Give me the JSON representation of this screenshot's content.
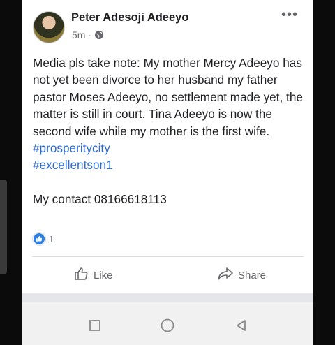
{
  "post": {
    "author": "Peter Adesoji Adeeyo",
    "time": "5m",
    "separator": "·",
    "privacy_icon": "globe-icon",
    "more_icon": "more-options-icon",
    "more_label": "•••",
    "body": [
      "Media pls take note: My mother Mercy Adeeyo has not yet been divorce to her husband my father pastor Moses Adeeyo, no settlement made yet, the matter is still in court. Tina Adeeyo is  now the second wife while my mother is the first wife."
    ],
    "hashtags": [
      "#prosperitycity",
      "#excellentson1"
    ],
    "contact": "My contact 08166618113"
  },
  "reactions": {
    "icon": "like-reaction-icon",
    "count": "1"
  },
  "actions": {
    "like_label": "Like",
    "share_label": "Share"
  },
  "navbar": {
    "icons": [
      "recent-apps-icon",
      "home-icon",
      "back-icon"
    ]
  },
  "colors": {
    "hashtag": "#2d6ad1",
    "like_badge": "#2f7de1",
    "text": "#1c1e21",
    "muted": "#65676b"
  }
}
